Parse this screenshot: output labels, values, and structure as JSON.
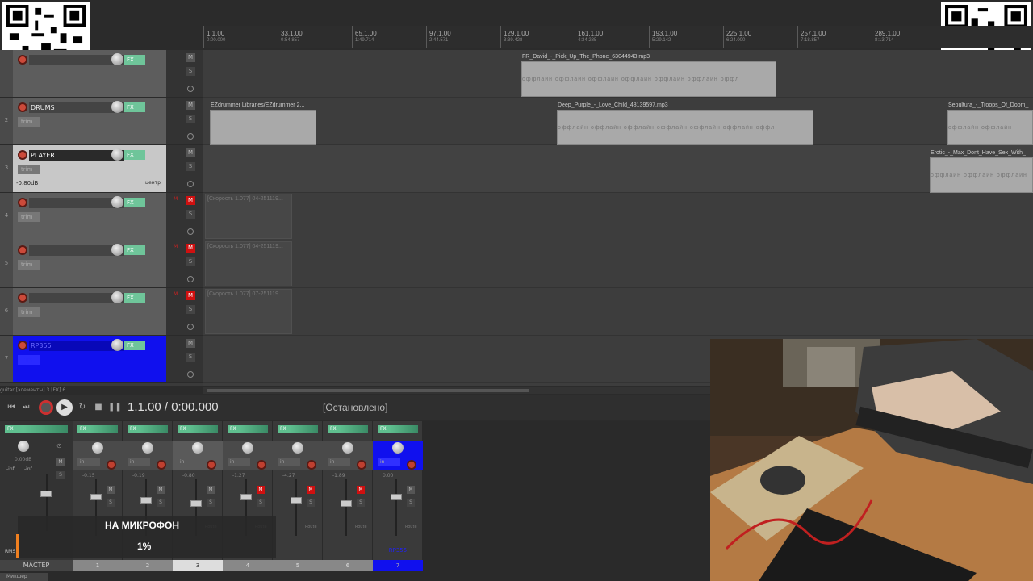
{
  "ruler": {
    "marks": [
      {
        "bar": "1.1.00",
        "time": "0:00.000"
      },
      {
        "bar": "33.1.00",
        "time": "0:54.857"
      },
      {
        "bar": "65.1.00",
        "time": "1:49.714"
      },
      {
        "bar": "97.1.00",
        "time": "2:44.571"
      },
      {
        "bar": "129.1.00",
        "time": "3:39.428"
      },
      {
        "bar": "161.1.00",
        "time": "4:34.285"
      },
      {
        "bar": "193.1.00",
        "time": "5:29.142"
      },
      {
        "bar": "225.1.00",
        "time": "6:24.000"
      },
      {
        "bar": "257.1.00",
        "time": "7:18.857"
      },
      {
        "bar": "289.1.00",
        "time": "8:13.714"
      }
    ]
  },
  "tracks": [
    {
      "num": "",
      "name": "",
      "fx": "FX",
      "trim": "",
      "vol": "",
      "pan": "",
      "m": "M",
      "s": "S"
    },
    {
      "num": "2",
      "name": "DRUMS",
      "fx": "FX",
      "trim": "trim",
      "vol": "",
      "pan": "",
      "m": "M",
      "s": "S"
    },
    {
      "num": "3",
      "name": "PLAYER",
      "fx": "FX",
      "trim": "trim",
      "vol": "-0.80dB",
      "pan": "центр",
      "m": "M",
      "s": "S"
    },
    {
      "num": "4",
      "name": "",
      "fx": "FX",
      "trim": "trim",
      "vol": "",
      "pan": "",
      "m": "M",
      "s": "S",
      "mm": "M"
    },
    {
      "num": "5",
      "name": "",
      "fx": "FX",
      "trim": "trim",
      "vol": "",
      "pan": "",
      "m": "M",
      "s": "S",
      "mm": "M"
    },
    {
      "num": "6",
      "name": "",
      "fx": "FX",
      "trim": "trim",
      "vol": "",
      "pan": "",
      "m": "M",
      "s": "S",
      "mm": "M"
    },
    {
      "num": "7",
      "name": "RP355",
      "fx": "FX",
      "trim": "trim",
      "vol": "",
      "pan": "",
      "m": "M",
      "s": "S"
    }
  ],
  "clips": [
    {
      "lane": 0,
      "title": "FR_David_-_Pick_Up_The_Phone_63044943.mp3",
      "offline": "оффлайн   оффлайн   оффлайн   оффлайн   оффлайн   оффлайн   оффл"
    },
    {
      "lane": 1,
      "title": "EZdrummer Libraries/EZdrummer 2...",
      "offline": ""
    },
    {
      "lane": 1,
      "title": "Deep_Purple_-_Love_Child_48139597.mp3",
      "offline": "оффлайн   оффлайн   оффлайн   оффлайн   оффлайн   оффлайн   оффл"
    },
    {
      "lane": 1,
      "title": "Sepultura_-_Troops_Of_Doom_",
      "offline": "оффлайн   оффлайн"
    },
    {
      "lane": 2,
      "title": "Erotic_-_Max_Dont_Have_Sex_With_",
      "offline": "оффлайн   оффлайн   оффлайн"
    },
    {
      "lane": 3,
      "title": "[Скорость 1.077] 04-251119...",
      "offline": ""
    },
    {
      "lane": 4,
      "title": "[Скорость 1.077] 04-251119...",
      "offline": ""
    },
    {
      "lane": 5,
      "title": "[Скорость 1.077] 07-251119...",
      "offline": ""
    }
  ],
  "status_small": "guitar [элементы] 3 [FX] 6",
  "transport": {
    "time": "1.1.00 / 0:00.000",
    "status": "[Остановлено]"
  },
  "mixer": {
    "master_label": "МАСТЕР",
    "master_vol": "0.00dB",
    "master_inf_l": "-inf",
    "master_inf_r": "-inf",
    "rms": "RMS",
    "tab": "Микшер",
    "mic_label": "НА МИКРОФОН",
    "mic_pct": "1%",
    "channels": [
      {
        "label": "1",
        "val": "-0.15",
        "name": "",
        "m": "M",
        "s": "S"
      },
      {
        "label": "2",
        "val": "-0.19",
        "name": "",
        "m": "M",
        "s": "S"
      },
      {
        "label": "3",
        "val": "-0.80",
        "name": "",
        "m": "M",
        "s": "S"
      },
      {
        "label": "4",
        "val": "-1.27",
        "name": "",
        "m": "M",
        "s": "S"
      },
      {
        "label": "5",
        "val": "-4.27",
        "name": "",
        "m": "M",
        "s": "S"
      },
      {
        "label": "6",
        "val": "-1.89",
        "name": "",
        "m": "M",
        "s": "S"
      },
      {
        "label": "7",
        "val": "0.00",
        "name": "RP355",
        "m": "M",
        "s": "S"
      }
    ]
  },
  "colors": {
    "record_arm": "#1010ee",
    "mute_on": "#d01010",
    "fx_green": "#6fc59a"
  }
}
